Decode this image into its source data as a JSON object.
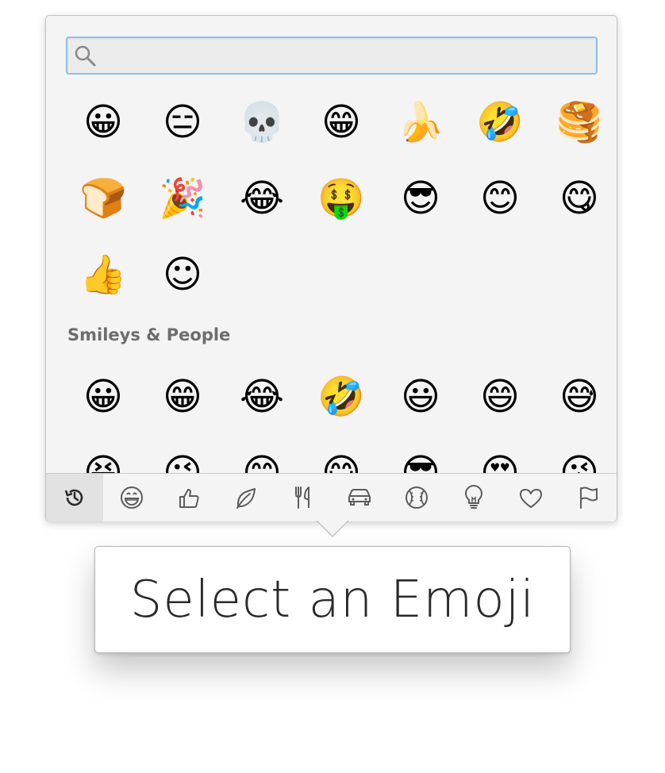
{
  "search": {
    "placeholder": "",
    "value": ""
  },
  "recent_emojis": [
    "😀",
    "😑",
    "💀",
    "😁",
    "🍌",
    "🤣",
    "🥞",
    "🍞",
    "🎉",
    "😂",
    "🤑",
    "😎",
    "😊",
    "😋",
    "👍",
    "☺"
  ],
  "section": {
    "title": "Smileys & People"
  },
  "people_emojis": [
    "😀",
    "😁",
    "😂",
    "🤣",
    "😃",
    "😄",
    "😅",
    "😆",
    "😉",
    "😊",
    "😋",
    "😎",
    "😍",
    "😘"
  ],
  "categories": [
    {
      "name": "recent",
      "icon": "history-icon",
      "active": true
    },
    {
      "name": "smileys",
      "icon": "smiley-icon",
      "active": false
    },
    {
      "name": "people",
      "icon": "thumbs-up-icon",
      "active": false
    },
    {
      "name": "nature",
      "icon": "leaf-icon",
      "active": false
    },
    {
      "name": "food",
      "icon": "fork-knife-icon",
      "active": false
    },
    {
      "name": "travel",
      "icon": "car-icon",
      "active": false
    },
    {
      "name": "activities",
      "icon": "baseball-icon",
      "active": false
    },
    {
      "name": "objects",
      "icon": "lightbulb-icon",
      "active": false
    },
    {
      "name": "symbols",
      "icon": "heart-icon",
      "active": false
    },
    {
      "name": "flags",
      "icon": "flag-icon",
      "active": false
    }
  ],
  "button": {
    "label": "Select an Emoji"
  },
  "colors": {
    "popover_bg": "#f4f4f4",
    "focus_border": "#8ec0e9",
    "section_text": "#6d6d6d",
    "icon_stroke": "#5c5c5c"
  }
}
